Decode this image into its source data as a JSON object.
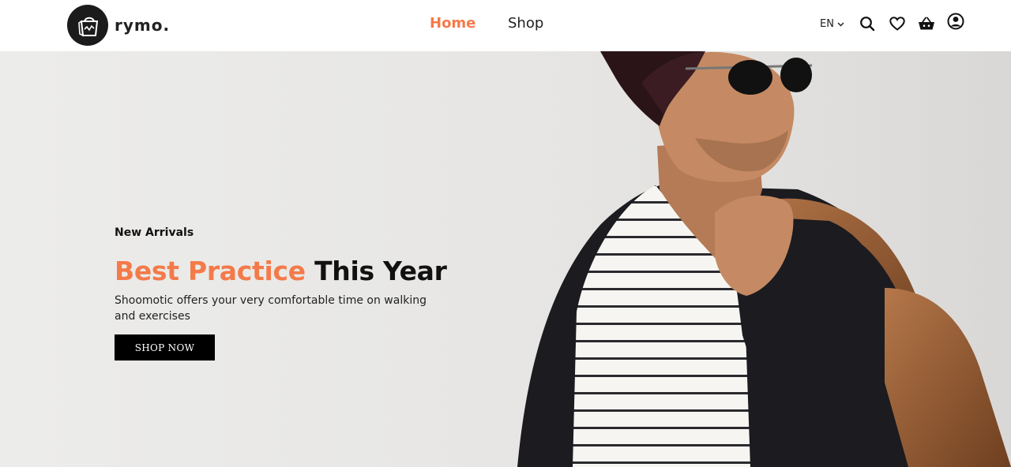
{
  "brand": {
    "name": "rymo.",
    "logo_icon": "shopping-bag-icon"
  },
  "nav": {
    "home": "Home",
    "shop": "Shop"
  },
  "header_tools": {
    "language": "EN",
    "icons": [
      "search-icon",
      "heart-icon",
      "basket-icon",
      "user-icon"
    ]
  },
  "hero": {
    "eyebrow": "New Arrivals",
    "headline_accent": "Best Practice",
    "headline_rest": " This Year",
    "subtext": "Shoomotic offers your very comfortable time on walking and exercises",
    "cta_label": "SHOP NOW"
  },
  "colors": {
    "accent": "#f47a4a",
    "text": "#111111",
    "cta_bg": "#000000"
  }
}
